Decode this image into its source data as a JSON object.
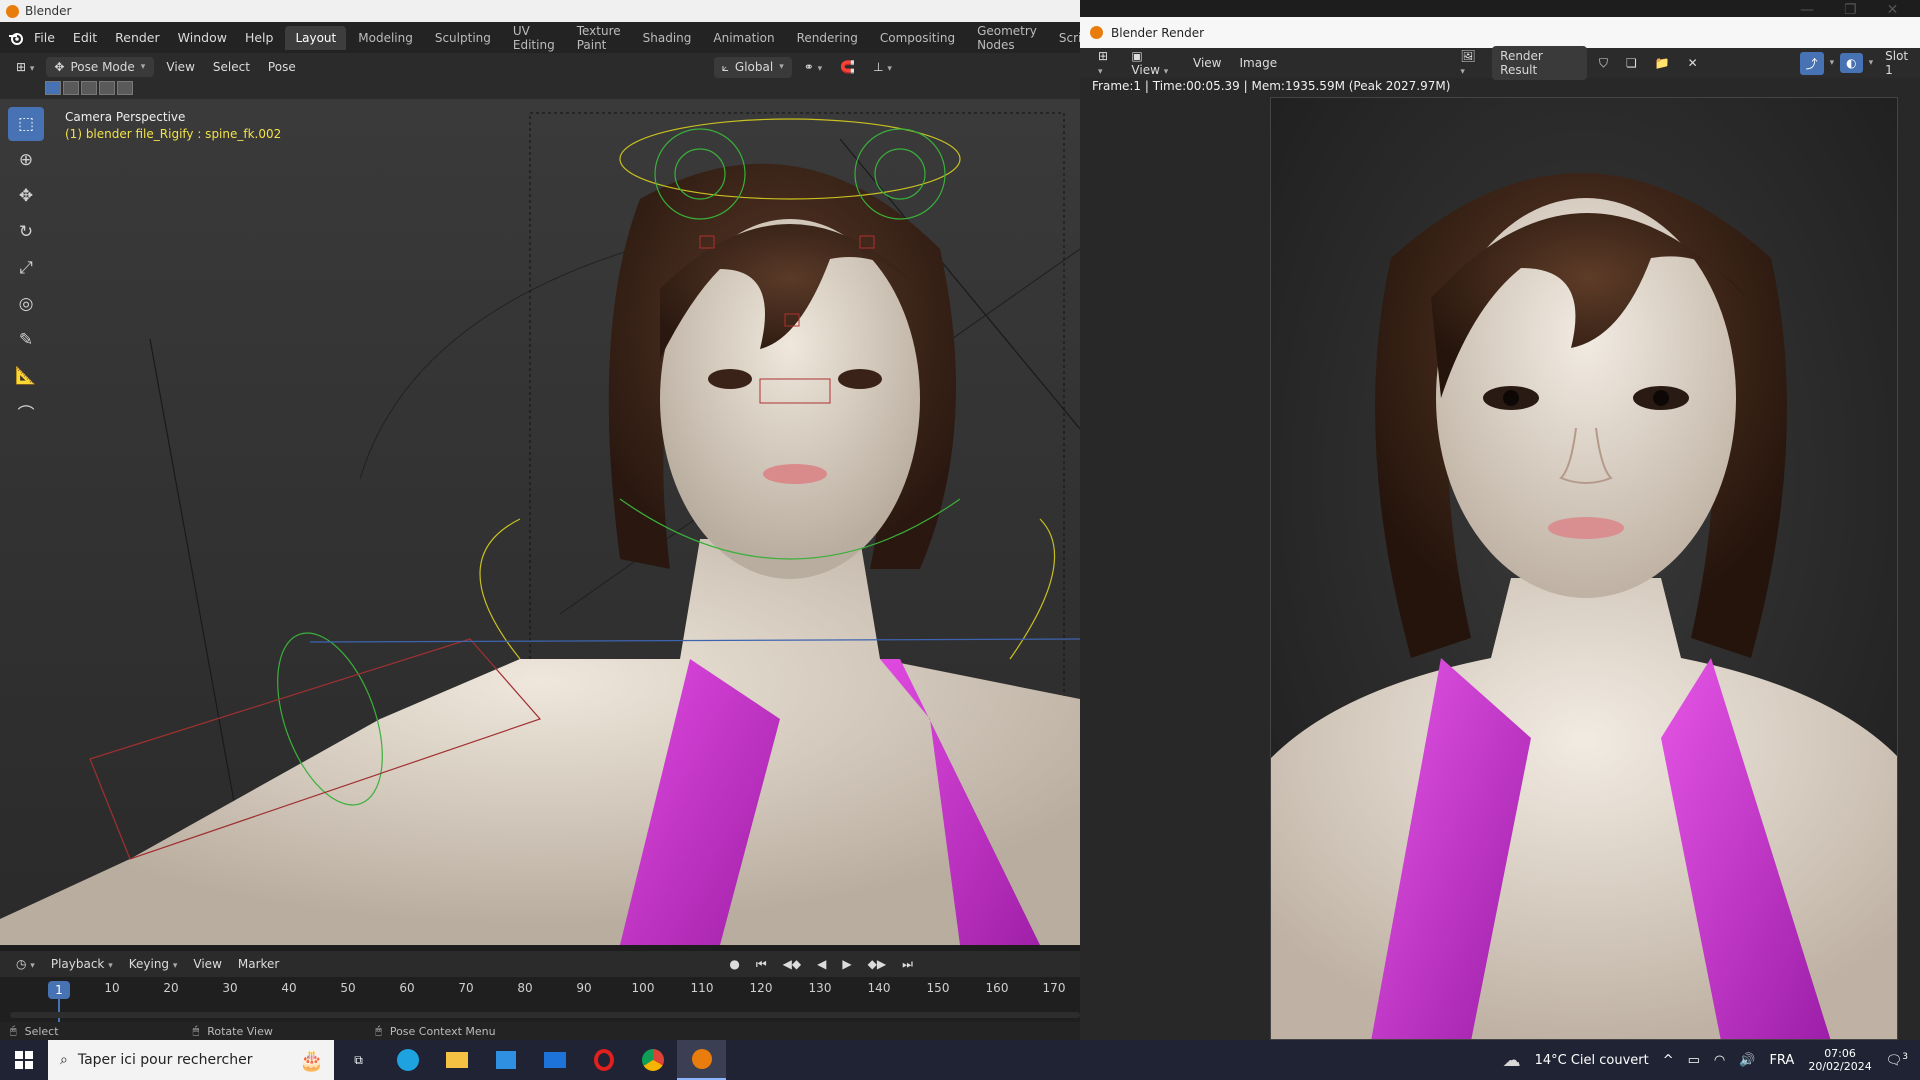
{
  "app": {
    "title": "Blender"
  },
  "menu": {
    "items": [
      "File",
      "Edit",
      "Render",
      "Window",
      "Help"
    ]
  },
  "workspaces": [
    "Layout",
    "Modeling",
    "Sculpting",
    "UV Editing",
    "Texture Paint",
    "Shading",
    "Animation",
    "Rendering",
    "Compositing",
    "Geometry Nodes",
    "Scripting"
  ],
  "workspace_add": "+",
  "header": {
    "mode": "Pose Mode",
    "menus": [
      "View",
      "Select",
      "Pose"
    ],
    "orientation": "Global"
  },
  "viewport": {
    "perspective": "Camera Perspective",
    "object_info": "(1) blender file_Rigify : spine_fk.002"
  },
  "toolbar": {
    "tools": [
      "select-box-icon",
      "cursor-icon",
      "move-icon",
      "rotate-icon",
      "scale-icon",
      "transform-icon",
      "annotate-icon",
      "measure-icon",
      "bone-relax-icon"
    ]
  },
  "timeline": {
    "menus": [
      "Playback",
      "Keying",
      "View",
      "Marker"
    ],
    "current_frame": "1",
    "ticks": [
      "10",
      "20",
      "30",
      "40",
      "50",
      "60",
      "70",
      "80",
      "90",
      "100",
      "110",
      "120",
      "130",
      "140",
      "150",
      "160",
      "170"
    ]
  },
  "status": {
    "select": "Select",
    "rotate": "Rotate View",
    "context": "Pose Context Menu"
  },
  "render_window": {
    "title": "Blender Render",
    "menus": [
      "View",
      "View",
      "Image"
    ],
    "image_name": "Render Result",
    "slot": "Slot 1",
    "stats": "Frame:1 | Time:00:05.39 | Mem:1935.59M (Peak 2027.97M)"
  },
  "taskbar": {
    "search_placeholder": "Taper ici pour rechercher",
    "weather": "14°C  Ciel couvert",
    "language": "FRA",
    "time": "07:06",
    "date": "20/02/2024",
    "notifications": "3"
  },
  "colors": {
    "accent": "#4772b3",
    "pink_top": "#d43bd0",
    "blender_orange": "#e87d0d"
  }
}
